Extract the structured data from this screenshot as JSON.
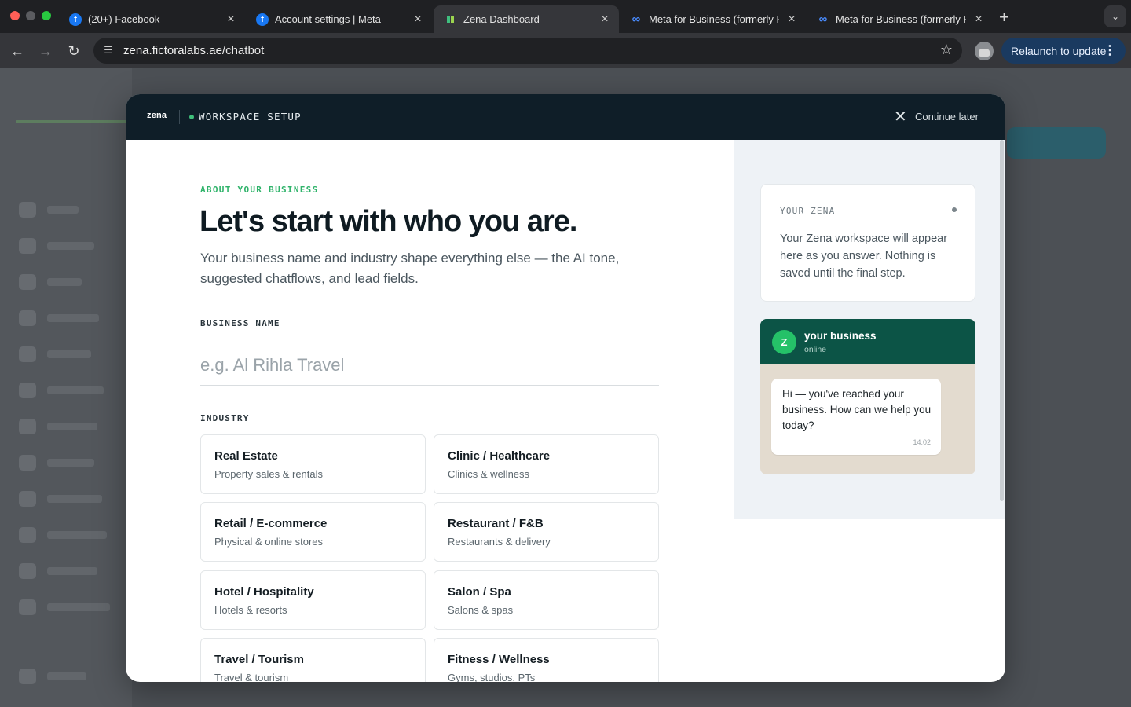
{
  "browser": {
    "tabs": [
      {
        "label": "(20+) Facebook",
        "favicon": "facebook-icon",
        "active": false
      },
      {
        "label": "Account settings | Meta",
        "favicon": "facebook-icon",
        "active": false
      },
      {
        "label": "Zena Dashboard",
        "favicon": "zena-icon",
        "active": true
      },
      {
        "label": "Meta for Business (formerly F",
        "favicon": "meta-icon",
        "active": false
      },
      {
        "label": "Meta for Business (formerly F",
        "favicon": "meta-icon",
        "active": false
      }
    ],
    "url_host": "zena.fictoralabs.ae",
    "url_path": "/chatbot",
    "relaunch_label": "Relaunch to update"
  },
  "modal": {
    "logo": "zena",
    "header_title": "WORKSPACE SETUP",
    "continue_later": "Continue later",
    "kicker": "ABOUT YOUR BUSINESS",
    "headline": "Let's start with who you are.",
    "lede": "Your business name and industry shape everything else — the AI tone, suggested chatflows, and lead fields.",
    "business_name_label": "BUSINESS NAME",
    "business_name_placeholder": "e.g. Al Rihla Travel",
    "business_name_value": "",
    "industry_label": "INDUSTRY",
    "industries": [
      {
        "title": "Real Estate",
        "subtitle": "Property sales & rentals"
      },
      {
        "title": "Clinic / Healthcare",
        "subtitle": "Clinics & wellness"
      },
      {
        "title": "Retail / E-commerce",
        "subtitle": "Physical & online stores"
      },
      {
        "title": "Restaurant / F&B",
        "subtitle": "Restaurants & delivery"
      },
      {
        "title": "Hotel / Hospitality",
        "subtitle": "Hotels & resorts"
      },
      {
        "title": "Salon / Spa",
        "subtitle": "Salons & spas"
      },
      {
        "title": "Travel / Tourism",
        "subtitle": "Travel & tourism"
      },
      {
        "title": "Fitness / Wellness",
        "subtitle": "Gyms, studios, PTs"
      }
    ]
  },
  "preview": {
    "your_zena_label": "YOUR ZENA",
    "your_zena_text": "Your Zena workspace will appear here as you answer. Nothing is saved until the final step.",
    "chat_avatar": "Z",
    "chat_name": "your business",
    "chat_status": "online",
    "chat_message": "Hi — you've reached your business. How can we help you today?",
    "chat_time": "14:02"
  },
  "colors": {
    "accent_green": "#2fb36a",
    "header_dark": "#0f1e28",
    "chat_header": "#0c5446",
    "relaunch_bg": "#1a3a60"
  }
}
